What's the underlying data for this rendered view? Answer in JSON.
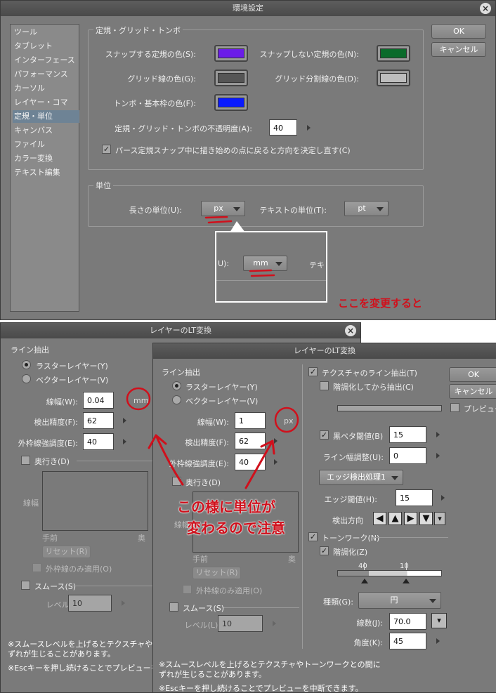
{
  "prefs": {
    "title": "環境設定",
    "close_glyph": "×",
    "sidebar": [
      "ツール",
      "タブレット",
      "インターフェース",
      "パフォーマンス",
      "カーソル",
      "レイヤー・コマ",
      "定規・単位",
      "キャンバス",
      "ファイル",
      "カラー変換",
      "テキスト編集"
    ],
    "selected_index": 6,
    "ok": "OK",
    "cancel": "キャンセル",
    "ruler_group": "定規・グリッド・トンボ",
    "snap_color_label": "スナップする定規の色(S):",
    "snap_color": "#6b1ce8",
    "nosnap_color_label": "スナップしない定規の色(N):",
    "nosnap_color": "#0a6b2b",
    "grid_color_label": "グリッド線の色(G):",
    "grid_color": "#555555",
    "grid_div_color_label": "グリッド分割線の色(D):",
    "grid_div_color": "#bdbdbd",
    "trim_color_label": "トンボ・基本枠の色(F):",
    "trim_color": "#0a1aff",
    "opacity_label": "定規・グリッド・トンボの不透明度(A):",
    "opacity_value": "40",
    "perspective_label": "パース定規スナップ中に描き始めの点に戻ると方向を決定し直す(C)",
    "unit_group": "単位",
    "length_unit_label": "長さの単位(U):",
    "length_unit_value": "px",
    "text_unit_label": "テキストの単位(T):",
    "text_unit_value": "pt",
    "inset_label": "U):",
    "inset_value": "mm",
    "inset_text": "テキ",
    "handwritten": "ここを変更すると"
  },
  "lt_back": {
    "title": "レイヤーのLT変換",
    "close_glyph": "×",
    "line_group": "ライン抽出",
    "raster": "ラスターレイヤー(Y)",
    "vector": "ベクターレイヤー(V)",
    "width_label": "線幅(W):",
    "width_value": "0.04",
    "width_unit": "mm",
    "precision_label": "検出精度(F):",
    "precision_value": "62",
    "outer_label": "外枠線強調度(E):",
    "outer_value": "40",
    "depth_label": "奥行き(D)",
    "graph_label": "線幅",
    "graph_front": "手前",
    "graph_back": "奥",
    "reset": "リセット(R)",
    "outer_only": "外枠線のみ適用(O)",
    "smooth": "スムース(S)",
    "level_label": "レベル(L):",
    "level_value": "10",
    "note1": "※スムースレベルを上げるとテクスチャやトー",
    "note2": "※Escキーを押し続けることでプレビューを中"
  },
  "lt_front": {
    "title": "レイヤーのLT変換",
    "line_group": "ライン抽出",
    "raster": "ラスターレイヤー(Y)",
    "vector": "ベクターレイヤー(V)",
    "width_label": "線幅(W):",
    "width_value": "1",
    "width_unit": "px",
    "precision_label": "検出精度(F):",
    "precision_value": "62",
    "outer_label": "外枠線強調度(E):",
    "outer_value": "40",
    "depth_label": "奥行き(D)",
    "graph_label": "線幅",
    "graph_front": "手前",
    "graph_back": "奥",
    "reset": "リセット(R)",
    "outer_only": "外枠線のみ適用(O)",
    "smooth": "スムース(S)",
    "level_label": "レベル(L):",
    "level_value": "10",
    "texture_line": "テクスチャのライン抽出(T)",
    "posterize_extract": "階調化してから抽出(C)",
    "ok": "OK",
    "cancel": "キャンセル",
    "preview": "プレビュー(",
    "black_threshold_label": "黒ベタ閾値(B)",
    "black_threshold_value": "15",
    "line_adjust_label": "ライン幅調整(U):",
    "line_adjust_value": "0",
    "edge_process": "エッジ検出処理1",
    "edge_threshold_label": "エッジ閾値(H):",
    "edge_threshold_value": "15",
    "direction_label": "検出方向",
    "direction_buttons": [
      "◀",
      "▲",
      "▶",
      "▼",
      "▾"
    ],
    "tonework": "トーンワーク(N)",
    "posterize": "階調化(Z)",
    "tone_low": "40",
    "tone_high": "10",
    "type_label": "種類(G):",
    "type_value": "円",
    "lines_label": "線数(J):",
    "lines_value": "70.0",
    "angle_label": "角度(K):",
    "angle_value": "45",
    "note1a": "※スムースレベルを上げるとテクスチャやトーンワークとの間に",
    "note1b": "ずれが生じることがあります。",
    "note2": "※Escキーを押し続けることでプレビューを中断できます。",
    "handwritten1": "この様に単位が",
    "handwritten2": "変わるので注意"
  },
  "back_note1b": "ずれが生じることがあります。"
}
